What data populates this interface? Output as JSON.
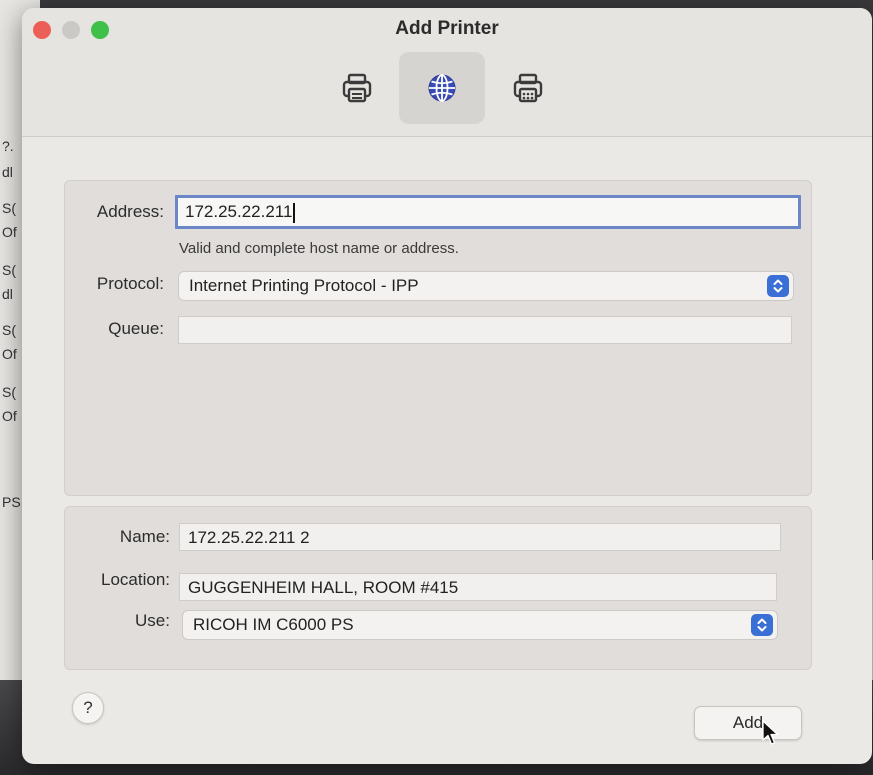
{
  "window": {
    "title": "Add Printer"
  },
  "toolbar": {
    "items": [
      {
        "icon": "printer-icon",
        "active": false
      },
      {
        "icon": "globe-icon",
        "active": true
      },
      {
        "icon": "fax-printer-icon",
        "active": false
      }
    ]
  },
  "form": {
    "address_label": "Address:",
    "address_value": "172.25.22.211",
    "address_hint": "Valid and complete host name or address.",
    "protocol_label": "Protocol:",
    "protocol_value": "Internet Printing Protocol - IPP",
    "queue_label": "Queue:",
    "queue_value": ""
  },
  "details": {
    "name_label": "Name:",
    "name_value": "172.25.22.211 2",
    "location_label": "Location:",
    "location_value": "GUGGENHEIM HALL, ROOM #415",
    "use_label": "Use:",
    "use_value": "RICOH IM C6000 PS"
  },
  "buttons": {
    "help_label": "?",
    "add_label": "Add"
  },
  "background_fragments": [
    "?.",
    "dl",
    "S(",
    "Of",
    "S(",
    "dl",
    "S(",
    "Of",
    "S(",
    "Of",
    "PS"
  ],
  "colors": {
    "accent": "#3a6fd6",
    "focus_ring": "#6c86c9",
    "close": "#ec5f56",
    "maximize": "#3ec04a"
  }
}
